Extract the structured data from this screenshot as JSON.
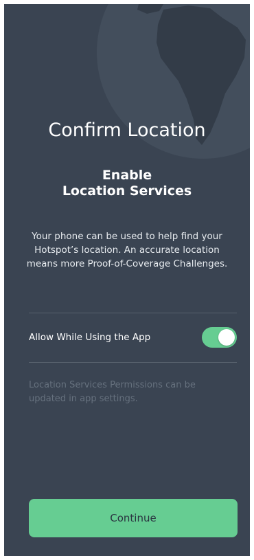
{
  "screen": {
    "title": "Confirm Location",
    "subtitle_line1": "Enable",
    "subtitle_line2": "Location Services",
    "description": "Your phone can be used to help find your Hotspot’s location. An accurate location means more Proof-of-Coverage Challenges.",
    "toggle_label": "Allow While Using the App",
    "toggle_on": true,
    "note": "Location Services Permissions can be updated in app settings.",
    "continue_label": "Continue"
  },
  "colors": {
    "background": "#3a4452",
    "accent": "#66cd92",
    "divider": "#57616d",
    "note_text": "#66717e"
  },
  "icons": {
    "background_graphic": "globe-icon"
  }
}
